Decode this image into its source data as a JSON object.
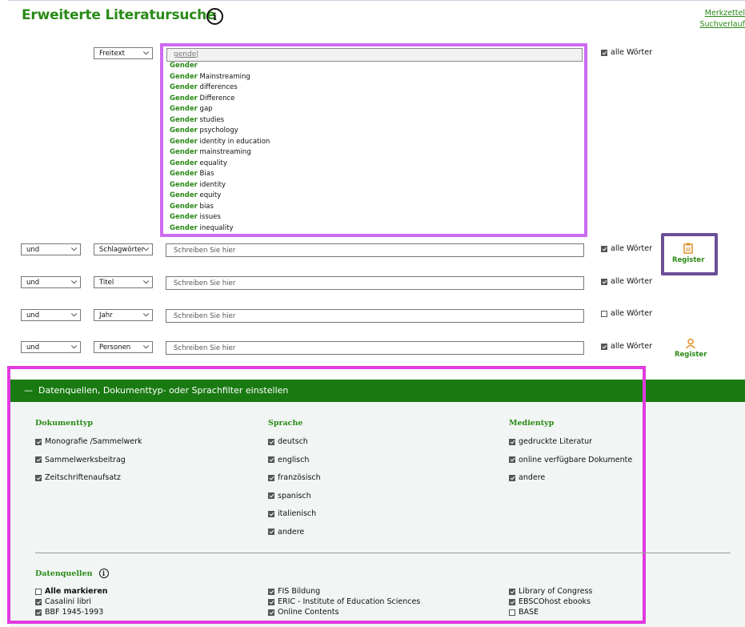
{
  "title": "Erweiterte Literatursuche",
  "links": {
    "merkzettel": "Merkzettel",
    "suchverlauf": "Suchverlauf"
  },
  "autocomplete": {
    "typed": "gende",
    "suggestions": [
      {
        "b": "Gender",
        "r": ""
      },
      {
        "b": "Gender",
        "r": " Mainstreaming"
      },
      {
        "b": "Gender",
        "r": " differences"
      },
      {
        "b": "Gender",
        "r": " Difference"
      },
      {
        "b": "Gender",
        "r": " gap"
      },
      {
        "b": "Gender",
        "r": " studies"
      },
      {
        "b": "Gender",
        "r": " psychology"
      },
      {
        "b": "Gender",
        "r": " identity in education"
      },
      {
        "b": "Gender",
        "r": " mainstreaming"
      },
      {
        "b": "Gender",
        "r": " equality"
      },
      {
        "b": "Gender",
        "r": " Bias"
      },
      {
        "b": "Gender",
        "r": " identity"
      },
      {
        "b": "Gender",
        "r": " equity"
      },
      {
        "b": "Gender",
        "r": " bias"
      },
      {
        "b": "Gender",
        "r": " issues"
      },
      {
        "b": "Gender",
        "r": " inequality"
      }
    ]
  },
  "rows": [
    {
      "field": "Freitext",
      "all": "alle Wörter"
    },
    {
      "op": "und",
      "field": "Schlagwörter",
      "placeholder": "Schreiben Sie hier",
      "all": "alle Wörter",
      "register": "Register"
    },
    {
      "op": "und",
      "field": "Titel",
      "placeholder": "Schreiben Sie hier",
      "all": "alle Wörter"
    },
    {
      "op": "und",
      "field": "Jahr",
      "placeholder": "Schreiben Sie hier",
      "all": "alle Wörter"
    },
    {
      "op": "und",
      "field": "Personen",
      "placeholder": "Schreiben Sie hier",
      "all": "alle Wörter",
      "register": "Register"
    }
  ],
  "filters": {
    "header": "Datenquellen, Dokumenttyp- oder Sprachfilter einstellen",
    "dokumenttyp": {
      "title": "Dokumenttyp",
      "items": [
        "Monografie /Sammelwerk",
        "Sammelwerksbeitrag",
        "Zeitschriftenaufsatz"
      ]
    },
    "sprache": {
      "title": "Sprache",
      "items": [
        "deutsch",
        "englisch",
        "französisch",
        "spanisch",
        "italienisch",
        "andere"
      ]
    },
    "medientyp": {
      "title": "Medientyp",
      "items": [
        "gedruckte Literatur",
        "online verfügbare Dokumente",
        "andere"
      ]
    },
    "datenquellen": {
      "title": "Datenquellen",
      "col1": [
        "Alle markieren",
        "Casalini libri",
        "BBF 1945-1993"
      ],
      "col2": [
        "FIS Bildung",
        "ERIC - Institute of Education Sciences",
        "Online Contents"
      ],
      "col3": [
        "Library of Congress",
        "EBSCOhost ebooks",
        "BASE"
      ]
    }
  },
  "colors": {
    "green": "#2a8a17",
    "header_green": "#1a7a12",
    "highlight_purple": "#cc6bf0",
    "highlight_magenta": "#e13ae0",
    "register_box": "#6b4f97"
  }
}
